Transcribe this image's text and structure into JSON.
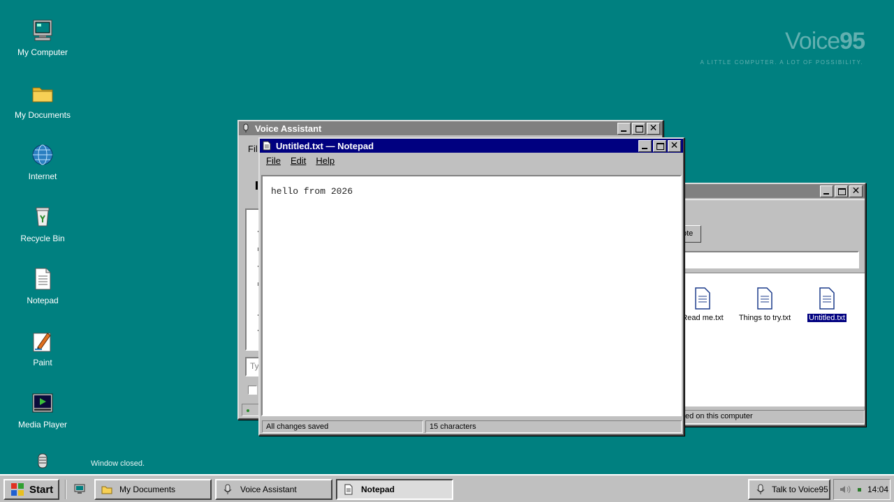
{
  "desktop": {
    "icons": [
      {
        "label": "My Computer"
      },
      {
        "label": "My Documents"
      },
      {
        "label": "Internet"
      },
      {
        "label": "Recycle Bin"
      },
      {
        "label": "Notepad"
      },
      {
        "label": "Paint"
      },
      {
        "label": "Media Player"
      }
    ],
    "brand_name_light": "Voice",
    "brand_name_bold": "95",
    "brand_tagline": "A LITTLE COMPUTER. A LOT OF POSSIBILITY.",
    "toast": "Window closed."
  },
  "voice_window": {
    "title": "Voice Assistant",
    "menu_file": "Fil",
    "input_placeholder": "Ty"
  },
  "explorer_window": {
    "button_label": "ote",
    "files": [
      {
        "label": "Read me.txt"
      },
      {
        "label": "Things to try.txt"
      },
      {
        "label": "Untitled.txt"
      }
    ],
    "status": "ed on this computer"
  },
  "notepad": {
    "title": "Untitled.txt — Notepad",
    "menu": {
      "file": "File",
      "edit": "Edit",
      "help": "Help"
    },
    "content": "hello from 2026",
    "status_saved": "All changes saved",
    "status_chars": "15 characters"
  },
  "taskbar": {
    "start": "Start",
    "items": [
      {
        "label": "My Documents"
      },
      {
        "label": "Voice Assistant"
      },
      {
        "label": "Notepad"
      }
    ],
    "talk_button": "Talk to Voice95",
    "clock": "14:04"
  },
  "colors": {
    "desktop": "#008080",
    "title_active": "#000080",
    "title_inactive": "#808080",
    "face": "#c0c0c0"
  }
}
